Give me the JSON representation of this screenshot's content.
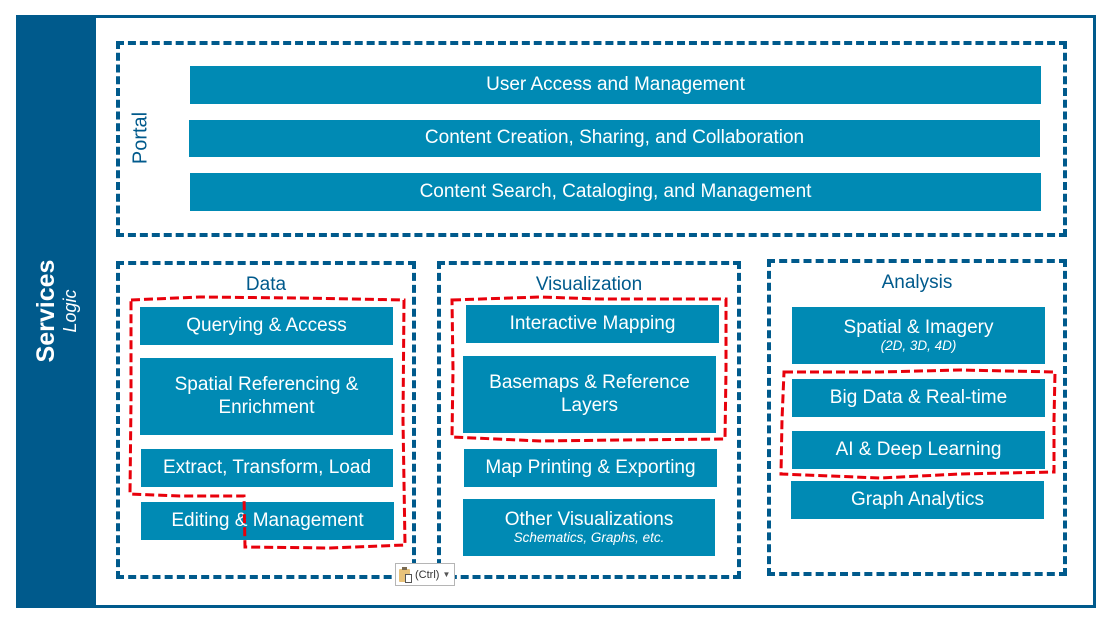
{
  "sidebar": {
    "title": "Services",
    "subtitle": "Logic"
  },
  "portal": {
    "label": "Portal",
    "items": [
      {
        "label": "User Access and Management"
      },
      {
        "label": "Content Creation, Sharing, and Collaboration"
      },
      {
        "label": "Content Search, Cataloging, and Management"
      }
    ]
  },
  "data_section": {
    "title": "Data",
    "items": [
      {
        "label": "Querying & Access",
        "highlighted": true
      },
      {
        "label": "Spatial Referencing & Enrichment",
        "highlighted": true
      },
      {
        "label": "Extract, Transform, Load",
        "highlighted": true
      },
      {
        "label": "Editing & Management",
        "highlighted": "partial"
      }
    ]
  },
  "visualization_section": {
    "title": "Visualization",
    "items": [
      {
        "label": "Interactive Mapping",
        "highlighted": true
      },
      {
        "label": "Basemaps & Reference Layers",
        "highlighted": true
      },
      {
        "label": "Map Printing & Exporting",
        "highlighted": false
      },
      {
        "label": "Other Visualizations",
        "sublabel": "Schematics, Graphs, etc.",
        "highlighted": false
      }
    ]
  },
  "analysis_section": {
    "title": "Analysis",
    "items": [
      {
        "label": "Spatial & Imagery",
        "sublabel": "(2D, 3D, 4D)",
        "highlighted": false
      },
      {
        "label": "Big Data & Real-time",
        "highlighted": true
      },
      {
        "label": "AI & Deep Learning",
        "highlighted": true
      },
      {
        "label": "Graph Analytics",
        "highlighted": false
      }
    ]
  },
  "paste_options": {
    "label": "(Ctrl)",
    "icon": "clipboard-paste-icon"
  },
  "colors": {
    "frame_blue": "#005A8C",
    "bar_blue": "#008AB4",
    "highlight_red": "#E8000B",
    "text_white": "#FFFFFF"
  }
}
